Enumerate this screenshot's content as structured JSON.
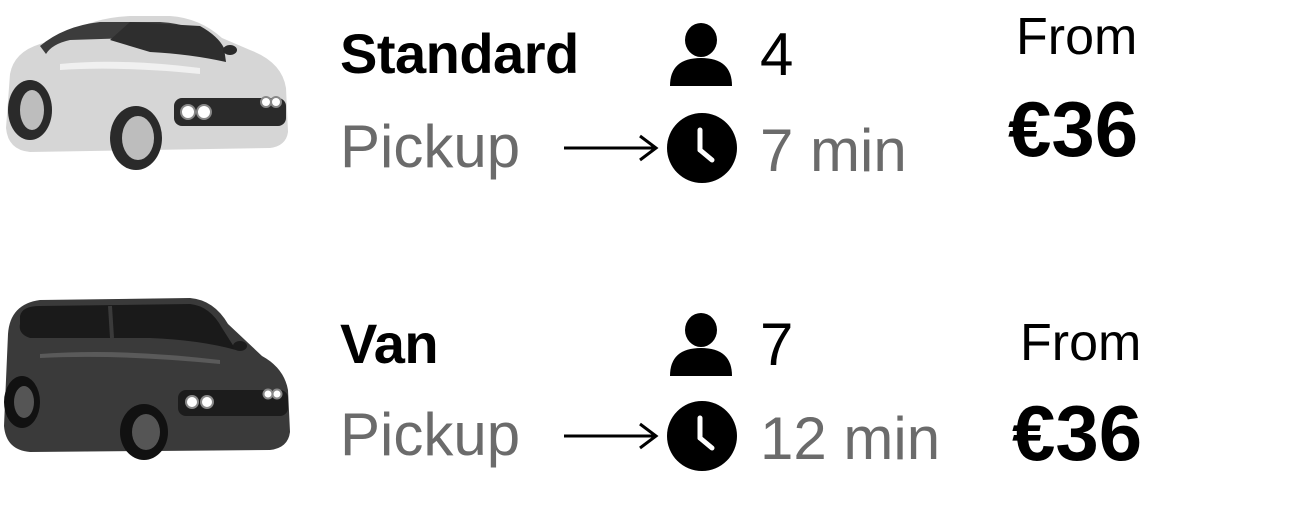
{
  "rides": [
    {
      "name": "Standard",
      "seats": "4",
      "pickup_label": "Pickup",
      "pickup_time": "7 min",
      "price_prefix": "From",
      "price": "€36",
      "car_color": "#d9d9d9"
    },
    {
      "name": "Van",
      "seats": "7",
      "pickup_label": "Pickup",
      "pickup_time": "12 min",
      "price_prefix": "From",
      "price": "€36",
      "car_color": "#3a3a3a"
    }
  ]
}
